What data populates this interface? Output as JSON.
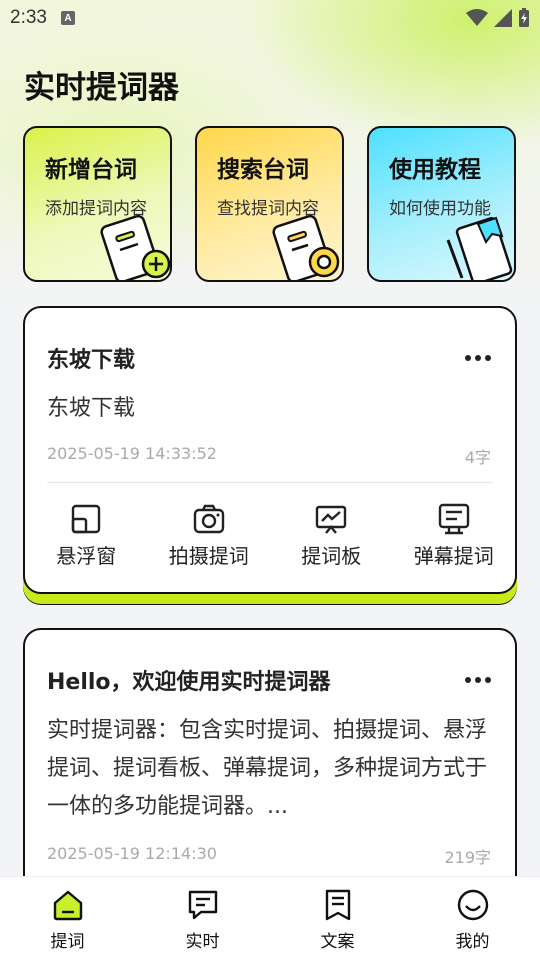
{
  "status": {
    "time": "2:33",
    "a_badge": "A"
  },
  "page_title": "实时提词器",
  "quick_cards": [
    {
      "title": "新增台词",
      "subtitle": "添加提词内容",
      "accent": "#d9f24a"
    },
    {
      "title": "搜索台词",
      "subtitle": "查找提词内容",
      "accent": "#ffd74a"
    },
    {
      "title": "使用教程",
      "subtitle": "如何使用功能",
      "accent": "#4ee0ff"
    }
  ],
  "scripts": [
    {
      "title": "东坡下载",
      "content": "东坡下载",
      "date": "2025-05-19 14:33:52",
      "count": "4字",
      "actions": [
        {
          "label": "悬浮窗",
          "icon": "floating-window-icon"
        },
        {
          "label": "拍摄提词",
          "icon": "camera-icon"
        },
        {
          "label": "提词板",
          "icon": "board-icon"
        },
        {
          "label": "弹幕提词",
          "icon": "danmaku-icon"
        }
      ]
    },
    {
      "title": "Hello，欢迎使用实时提词器",
      "content": "实时提词器：包含实时提词、拍摄提词、悬浮提词、提词看板、弹幕提词，多种提词方式于一体的多功能提词器。...",
      "date": "2025-05-19 12:14:30",
      "count": "219字"
    }
  ],
  "tabs": [
    {
      "label": "提词",
      "icon": "home-icon",
      "active": true
    },
    {
      "label": "实时",
      "icon": "chat-icon"
    },
    {
      "label": "文案",
      "icon": "document-icon"
    },
    {
      "label": "我的",
      "icon": "profile-icon"
    }
  ],
  "colors": {
    "accent_green": "#c6ea1a",
    "active_tab": "#c8f02a"
  }
}
